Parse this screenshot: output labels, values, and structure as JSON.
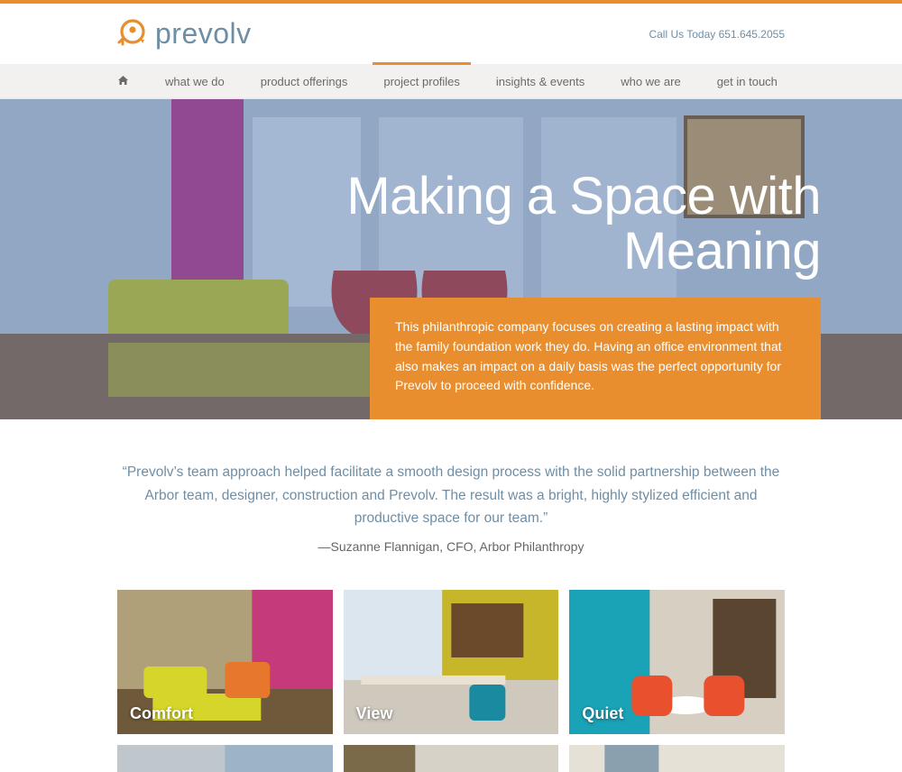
{
  "header": {
    "brand_name": "prevolv",
    "call_us_prefix": "Call Us Today ",
    "phone": "651.645.2055"
  },
  "nav": {
    "items": [
      {
        "label": "what we do",
        "active": false
      },
      {
        "label": "product offerings",
        "active": false
      },
      {
        "label": "project profiles",
        "active": true
      },
      {
        "label": "insights & events",
        "active": false
      },
      {
        "label": "who we are",
        "active": false
      },
      {
        "label": "get in touch",
        "active": false
      }
    ]
  },
  "hero": {
    "title_line1": "Making a Space with",
    "title_line2": "Meaning",
    "box_text": "This philanthropic company focuses on creating a lasting impact with the family foundation work they do. Having an office environment that also makes an impact on a daily basis was the perfect opportunity for Prevolv to proceed with confidence."
  },
  "quote": {
    "text": "“Prevolv’s team approach helped facilitate a smooth design process with the solid partnership between the Arbor team, designer, construction and Prevolv. The result was a bright, highly stylized efficient and productive space for our team.”",
    "attribution": "—Suzanne Flannigan, CFO, Arbor Philanthropy"
  },
  "gallery": {
    "tiles": [
      {
        "caption": "Comfort"
      },
      {
        "caption": "View"
      },
      {
        "caption": "Quiet"
      }
    ]
  },
  "colors": {
    "accent": "#e88e2e",
    "brand_blue": "#6e8ea6"
  }
}
